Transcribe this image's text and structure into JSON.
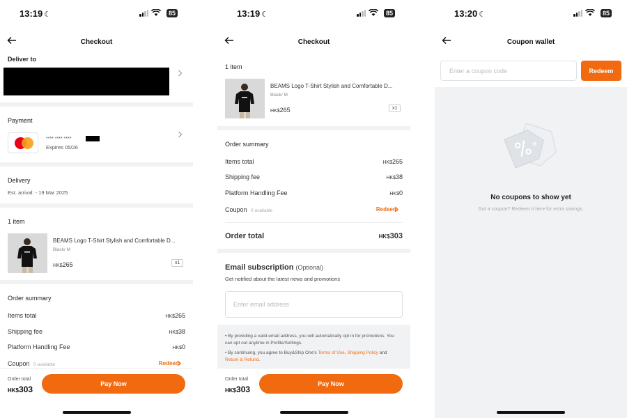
{
  "status_bar": {
    "s1_time": "13:19",
    "s2_time": "13:19",
    "s3_time": "13:20",
    "battery": "85"
  },
  "checkout": {
    "title": "Checkout",
    "deliver_to_label": "Deliver to",
    "payment_label": "Payment",
    "card_number_masked": "**** **** ****",
    "card_expiry": "Expires 05/26",
    "delivery_label": "Delivery",
    "delivery_estimate": "Est. arrival: - 19 Mar 2025",
    "items_label": "1 item",
    "product": {
      "name": "BEAMS Logo T-Shirt Stylish and Comfortable D...",
      "variant": "Black/ M",
      "currency": "HK$",
      "price": "265",
      "quantity": "x1"
    },
    "order_summary": {
      "title": "Order summary",
      "rows": [
        {
          "label": "Items total",
          "currency": "HK$",
          "value": "265"
        },
        {
          "label": "Shipping fee",
          "currency": "HK$",
          "value": "38"
        },
        {
          "label": "Platform Handling Fee",
          "currency": "HK$",
          "value": "0"
        }
      ],
      "coupon_label": "Coupon",
      "coupon_available": "0 available",
      "redeem_label": "Redeem",
      "order_total_label": "Order total",
      "order_total_currency": "HK$",
      "order_total_value": "303"
    },
    "email_subscription": {
      "title": "Email subscription",
      "optional": "(Optional)",
      "subtitle": "Get notified about the latest news and promotions",
      "placeholder": "Enter email address",
      "notice_1": "By providing a valid email address, you will automatically opt in for promotions. You can opt out anytime in Profile/Settings.",
      "notice_2_prefix": "By continuing, you agree to Buy&Ship One's",
      "terms_link": "Terms of Use",
      "shipping_link": "Shipping Policy",
      "notice_2_and": "and",
      "refund_link": "Return & Refund"
    },
    "footer": {
      "order_total_label": "Order total",
      "currency": "HK$",
      "value": "303",
      "pay_now": "Pay Now"
    }
  },
  "coupon_wallet": {
    "title": "Coupon wallet",
    "placeholder": "Enter a coupon code",
    "redeem_button": "Redeem",
    "empty_title": "No coupons to show yet",
    "empty_subtitle": "Got a coupon? Redeem it here for extra savings."
  },
  "colors": {
    "accent": "#f26a0f",
    "section_bg": "#f1f2f4",
    "mastercard_red": "#eb001b",
    "mastercard_orange": "#f79e1b"
  },
  "icons": [
    "back-arrow-icon",
    "chevron-right-icon",
    "wifi-icon",
    "signal-icon",
    "battery-icon",
    "moon-icon",
    "mastercard-icon",
    "coupon-tag-icon"
  ]
}
